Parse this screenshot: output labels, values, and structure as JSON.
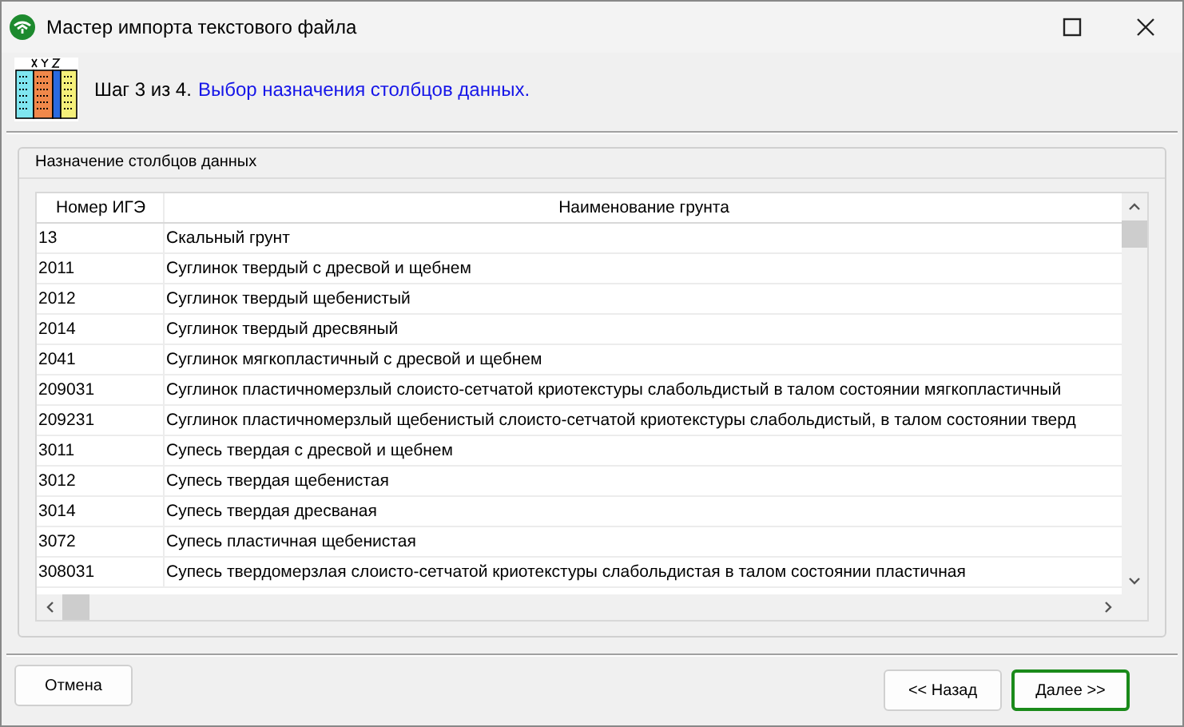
{
  "window": {
    "title": "Мастер импорта текстового файла"
  },
  "header": {
    "step": "Шаг 3 из 4.",
    "step_title": "Выбор назначения столбцов данных."
  },
  "group": {
    "title": "Назначение столбцов данных"
  },
  "table": {
    "columns": [
      "Номер ИГЭ",
      "Наименование грунта"
    ],
    "rows": [
      [
        "13",
        "Скальный грунт"
      ],
      [
        "2011",
        "Суглинок твердый с дресвой и щебнем"
      ],
      [
        "2012",
        "Суглинок твердый щебенистый"
      ],
      [
        "2014",
        "Суглинок твердый дресвяный"
      ],
      [
        "2041",
        "Суглинок мягкопластичный с дресвой и щебнем"
      ],
      [
        "209031",
        "Суглинок пластичномерзлый слоисто-сетчатой криотекстуры слабольдистый в талом состоянии мягкопластичный"
      ],
      [
        "209231",
        "Суглинок пластичномерзлый щебенистый слоисто-сетчатой криотекстуры слабольдистый, в талом состоянии тверд"
      ],
      [
        "3011",
        "Супесь твердая с дресвой и щебнем"
      ],
      [
        "3012",
        "Супесь твердая щебенистая"
      ],
      [
        "3014",
        "Супесь твердая дресваная"
      ],
      [
        "3072",
        "Супесь пластичная щебенистая"
      ],
      [
        "308031",
        "Супесь твердомерзлая слоисто-сетчатой криотекстуры слабольдистая в талом состоянии пластичная"
      ]
    ]
  },
  "buttons": {
    "cancel": "Отмена",
    "back": "<< Назад",
    "next": "Далее >>"
  }
}
